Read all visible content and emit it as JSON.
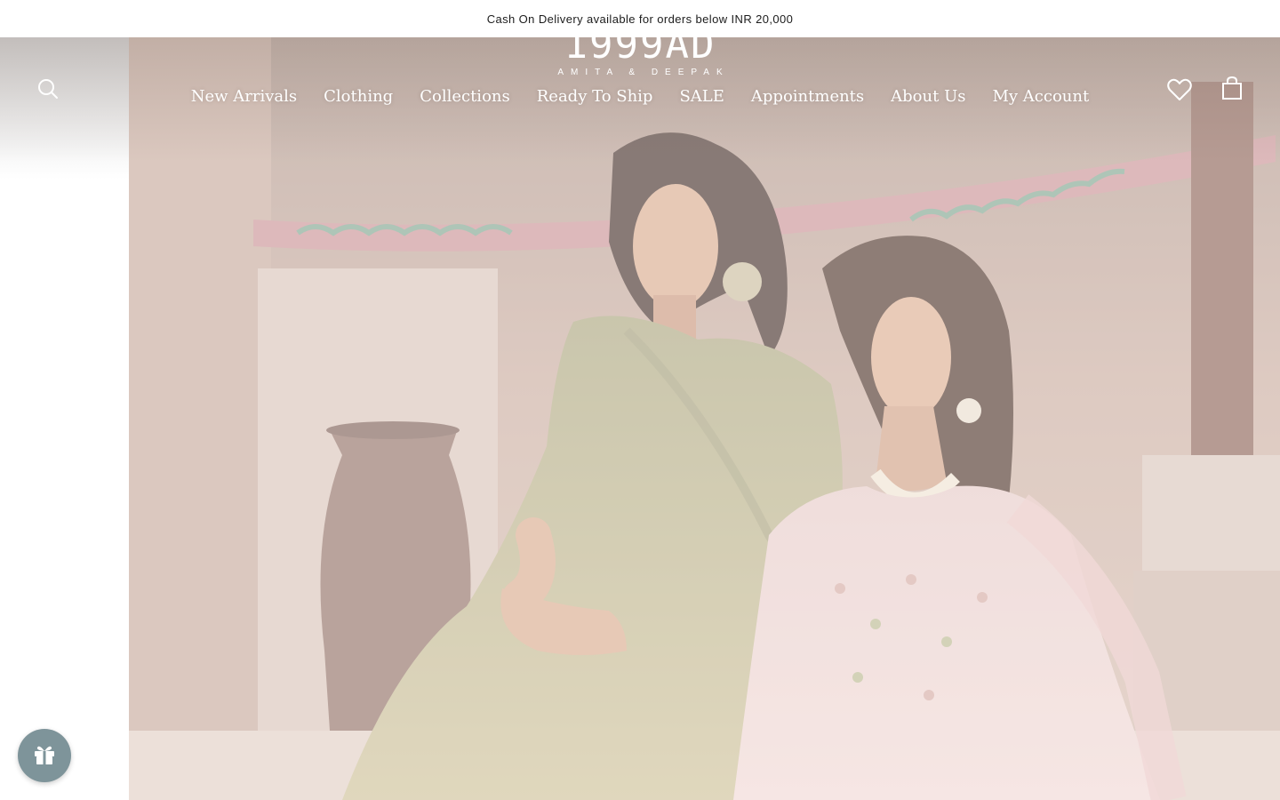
{
  "announcement": {
    "text": "Cash On Delivery available for orders below INR 20,000"
  },
  "header": {
    "logo": {
      "main": "1999AD",
      "sub": "AMITA & DEEPAK"
    },
    "icons": {
      "search": "search-icon",
      "wishlist": "heart-icon",
      "cart": "bag-icon"
    }
  },
  "nav": {
    "items": [
      {
        "label": "New Arrivals"
      },
      {
        "label": "Clothing"
      },
      {
        "label": "Collections"
      },
      {
        "label": "Ready To Ship"
      },
      {
        "label": "SALE"
      },
      {
        "label": "Appointments"
      },
      {
        "label": "About Us"
      },
      {
        "label": "My Account"
      }
    ]
  },
  "floating": {
    "gift_icon": "gift-icon"
  },
  "colors": {
    "announcement_bg": "#ffffff",
    "announcement_text": "#1c1c1c",
    "nav_text": "#ffffff",
    "gift_button_bg": "#7e949a"
  }
}
